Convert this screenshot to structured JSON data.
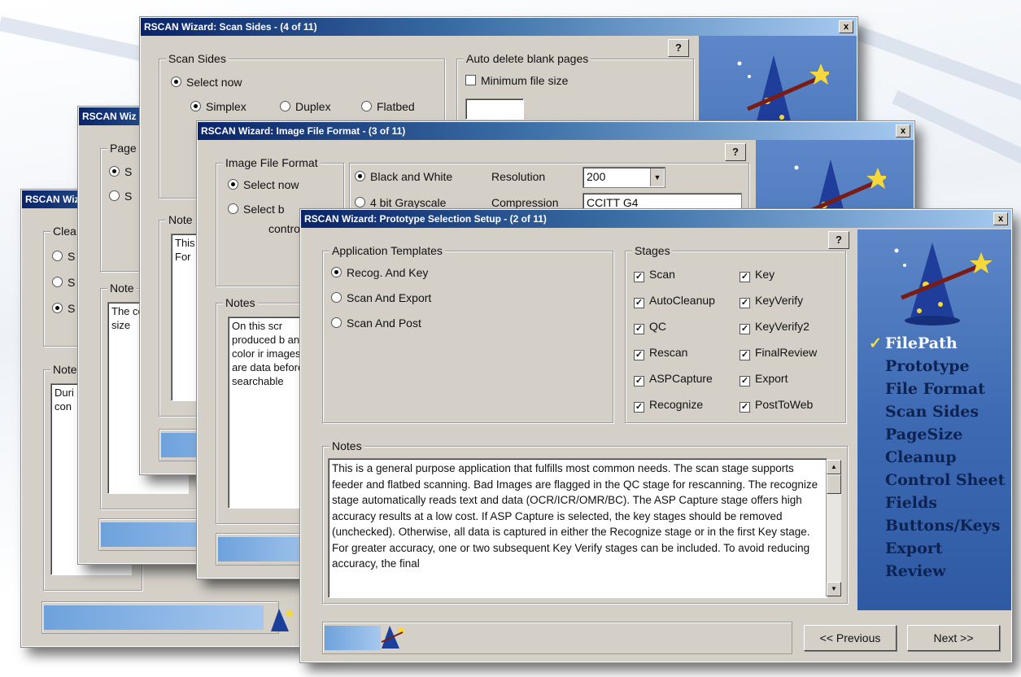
{
  "w4": {
    "title": "RSCAN Wiz",
    "grp_label": "Clea",
    "notes_label": "Note",
    "notes_text": "Duri are here con"
  },
  "w3": {
    "title": "RSCAN Wiz",
    "grp_label": "Page",
    "r1": "S",
    "r2": "S",
    "notes_label": "Note",
    "notes_text": "The cont will c size"
  },
  "w2": {
    "title": "RSCAN Wizard: Scan Sides - (4 of 11)",
    "scan_sides_label": "Scan Sides",
    "select_now": "Select now",
    "simplex": "Simplex",
    "duplex": "Duplex",
    "flatbed": "Flatbed",
    "auto_delete_label": "Auto delete blank pages",
    "min_file_size": "Minimum file size",
    "notes_label": "Note",
    "notes_text": "This she sele For"
  },
  "w1": {
    "title": "RSCAN Wizard: Image File Format - (3 of 11)",
    "format_label": "Image File Format",
    "select_now": "Select now",
    "select_by": "Select b",
    "control": "control",
    "bw": "Black and White",
    "resolution_label": "Resolution",
    "resolution_value": "200",
    "gray": "4 bit Grayscale",
    "compression_label": "Compression",
    "compression_value": "CCITT G4 ",
    "notes_label": "Notes",
    "notes_text": "On this scr produced b and color ir images are data before searchable"
  },
  "main": {
    "title": "RSCAN Wizard: Prototype Selection Setup - (2 of 11)",
    "help": "?",
    "close": "x",
    "templates_label": "Application Templates",
    "templates": [
      "Recog. And Key",
      "Scan And Export",
      "Scan And Post"
    ],
    "stages_label": "Stages",
    "stages_left": [
      "Scan",
      "AutoCleanup",
      "QC",
      "Rescan",
      "ASPCapture",
      "Recognize"
    ],
    "stages_right": [
      "Key",
      "KeyVerify",
      "KeyVerify2",
      "FinalReview",
      "Export",
      "PostToWeb"
    ],
    "notes_label": "Notes",
    "notes_text": "This is a general purpose application that fulfills most common needs.  The scan stage supports feeder and flatbed scanning.  Bad Images are flagged in the QC stage for rescanning.  The recognize stage automatically reads text and data (OCR/ICR/OMR/BC).  The ASP Capture stage offers high accuracy results at a low cost.  If ASP Capture is selected, the key stages should be removed (unchecked).  Otherwise, all data is captured in either the Recognize stage or in the first Key stage.  For greater accuracy, one or two subsequent Key Verify stages can be included.  To avoid reducing accuracy, the final",
    "steps": [
      "FilePath",
      "Prototype",
      "File Format",
      "Scan Sides",
      "PageSize",
      "Cleanup",
      "Control Sheet",
      "Fields",
      "Buttons/Keys",
      "Export",
      "Review"
    ],
    "check_mark": "✓",
    "prev_label": "<< Previous",
    "next_label": "Next >>",
    "progress_fraction": 0.12
  }
}
